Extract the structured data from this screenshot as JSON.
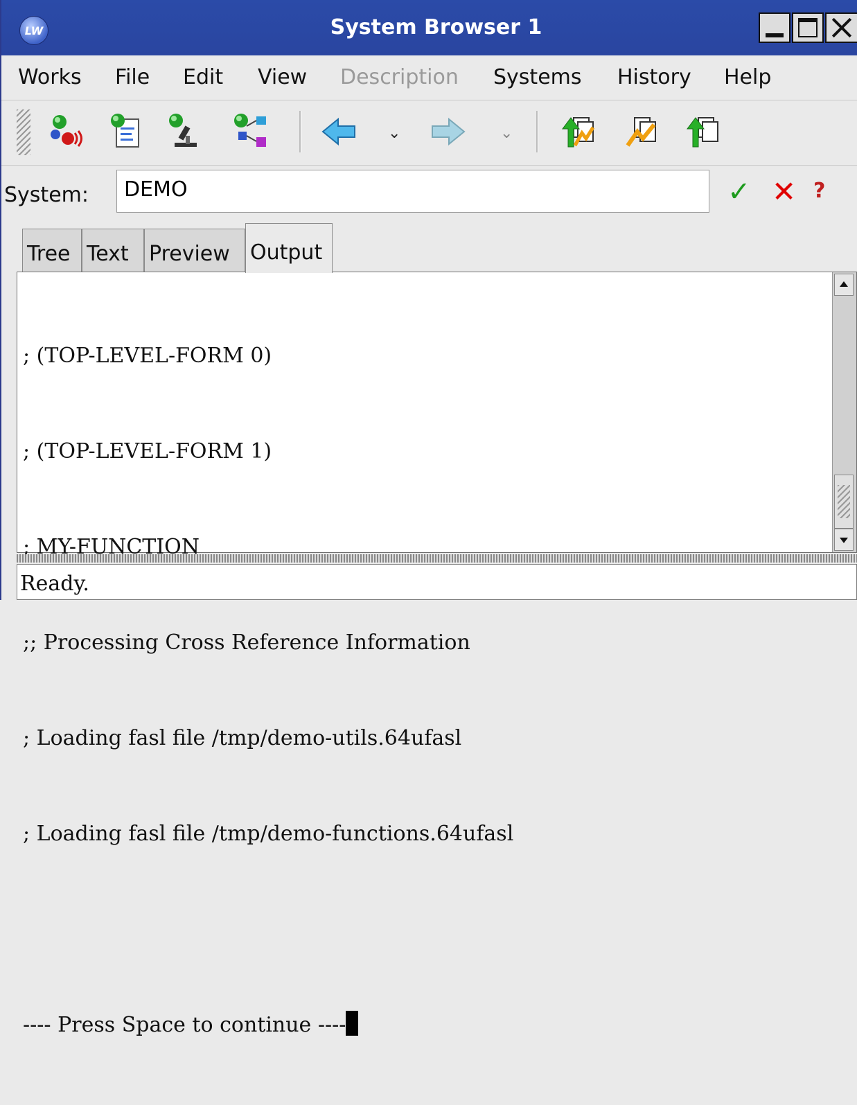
{
  "window": {
    "title": "System Browser 1",
    "app_icon_label": "LW"
  },
  "menubar": {
    "items": [
      {
        "label": "Works",
        "mnemonic": "W"
      },
      {
        "label": "File",
        "mnemonic": "F"
      },
      {
        "label": "Edit",
        "mnemonic": "E"
      },
      {
        "label": "View",
        "mnemonic": "V"
      },
      {
        "label": "Description",
        "disabled": true
      },
      {
        "label": "Systems",
        "mnemonic": "S"
      },
      {
        "label": "History",
        "mnemonic": "t"
      },
      {
        "label": "Help",
        "mnemonic": "H"
      }
    ]
  },
  "toolbar": {
    "buttons": [
      "inspect-system-icon",
      "edit-system-icon",
      "browse-system-icon",
      "system-tree-icon",
      "back-arrow-icon",
      "forward-arrow-icon",
      "compile-and-load-icon",
      "compile-icon",
      "load-icon"
    ],
    "dropdown_glyph": "⌄"
  },
  "system_bar": {
    "label": "System:",
    "value": "DEMO",
    "ok_glyph": "✓",
    "cancel_glyph": "✕",
    "help_glyph": "?"
  },
  "tabs": {
    "items": [
      {
        "label": "Tree"
      },
      {
        "label": "Text"
      },
      {
        "label": "Preview"
      },
      {
        "label": "Output",
        "active": true
      }
    ]
  },
  "output": {
    "lines": [
      "; (TOP-LEVEL-FORM 0)",
      "; (TOP-LEVEL-FORM 1)",
      "; MY-FUNCTION",
      ";; Processing Cross Reference Information",
      "; Loading fasl file /tmp/demo-utils.64ufasl",
      "; Loading fasl file /tmp/demo-functions.64ufasl",
      "",
      "---- Press Space to continue ----"
    ]
  },
  "status": {
    "text": "Ready."
  },
  "colors": {
    "titlebar": "#2b4ba8",
    "ok": "#1e9b1e",
    "cancel": "#e00000"
  }
}
